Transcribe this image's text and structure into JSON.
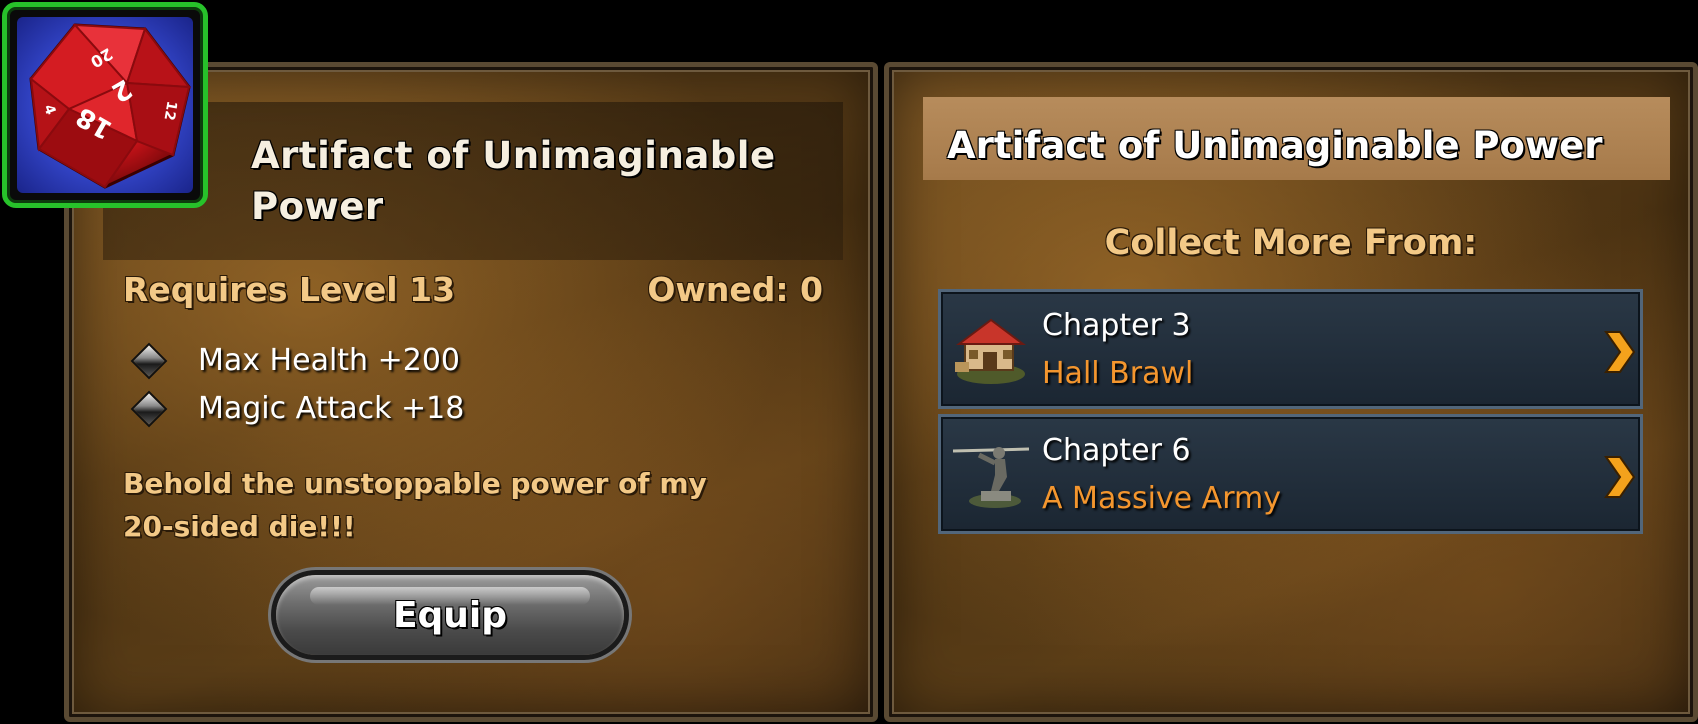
{
  "item": {
    "icon": "d20-die-icon",
    "title": "Artifact of Unimaginable Power",
    "requires": "Requires Level 13",
    "owned": "Owned: 0",
    "stats": [
      "Max Health +200",
      "Magic Attack +18"
    ],
    "description": "Behold the unstoppable power of my 20-sided die!!!",
    "equip_label": "Equip",
    "die_numbers": [
      "20",
      "2",
      "18",
      "4",
      "12"
    ]
  },
  "sources": {
    "title": "Artifact of Unimaginable Power",
    "heading": "Collect More From:",
    "rows": [
      {
        "chapter": "Chapter 3",
        "name": "Hall Brawl",
        "icon": "hall-building-icon"
      },
      {
        "chapter": "Chapter 6",
        "name": "A Massive Army",
        "icon": "warrior-statue-icon"
      }
    ]
  },
  "colors": {
    "rarity_border": "#27c22a",
    "source_name": "#f4962e",
    "gold_text": "#f3c987"
  }
}
